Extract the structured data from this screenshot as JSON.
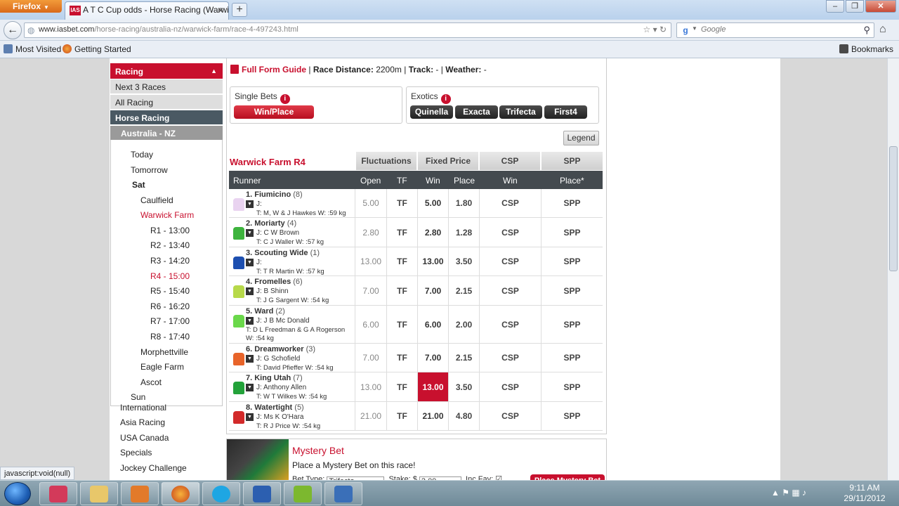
{
  "browser": {
    "menu_button": "Firefox",
    "tab_title": "A T C Cup odds - Horse Racing (Warwic...",
    "url_host": "www.iasbet.com",
    "url_path": "/horse-racing/australia-nz/warwick-farm/race-4-497243.html",
    "search_placeholder": "Google",
    "bookmarks": [
      "Most Visited",
      "Getting Started"
    ],
    "bookmarks_right": "Bookmarks",
    "status": "javascript:void(null)"
  },
  "sidebar": {
    "header": "Racing",
    "items": [
      "Next 3 Races",
      "All Racing"
    ],
    "active": "Horse Racing",
    "region": "Australia - NZ",
    "tree": {
      "today": "Today",
      "tomorrow": "Tomorrow",
      "sat": "Sat",
      "caulfield": "Caulfield",
      "warwick": "Warwick Farm",
      "races": [
        "R1 - 13:00",
        "R2 - 13:40",
        "R3 - 14:20",
        "R4 - 15:00",
        "R5 - 15:40",
        "R6 - 16:20",
        "R7 - 17:00",
        "R8 - 17:40"
      ],
      "morphettville": "Morphettville",
      "eagle_farm": "Eagle Farm",
      "ascot": "Ascot",
      "sun": "Sun"
    },
    "extra": [
      "International",
      "Asia Racing",
      "USA Canada",
      "Specials",
      "Jockey Challenge"
    ]
  },
  "race_info": {
    "form_guide": "Full Form Guide",
    "separator": "|",
    "distance_label": "Race Distance:",
    "distance": "2200m",
    "track_label": "Track:",
    "track": "-",
    "weather_label": "Weather:",
    "weather": "-"
  },
  "bets": {
    "single_title": "Single Bets",
    "single_button": "Win/Place",
    "exotics_title": "Exotics",
    "exotics": [
      "Quinella",
      "Exacta",
      "Trifecta",
      "First4"
    ],
    "legend": "Legend"
  },
  "table": {
    "race_title": "Warwick Farm R4",
    "groups": [
      "Fluctuations",
      "Fixed Price",
      "CSP",
      "SPP"
    ],
    "headers": [
      "Runner",
      "Open",
      "TF",
      "Win",
      "Place",
      "Win",
      "Place*"
    ],
    "runners": [
      {
        "name": "1. Fiumicino",
        "barrier": "(8)",
        "jockey": "J:",
        "trainer": "T: M, W & J Hawkes W: :59 kg",
        "open": "5.00",
        "tf": "TF",
        "win": "5.00",
        "place": "1.80",
        "csp": "CSP",
        "spp": "SPP",
        "silk": "#e9d3f0"
      },
      {
        "name": "2. Moriarty",
        "barrier": "(4)",
        "jockey": "J: C W Brown",
        "trainer": "T: C J Waller W: :57 kg",
        "open": "2.80",
        "tf": "TF",
        "win": "2.80",
        "place": "1.28",
        "csp": "CSP",
        "spp": "SPP",
        "silk": "#3db33d"
      },
      {
        "name": "3. Scouting Wide",
        "barrier": "(1)",
        "jockey": "J:",
        "trainer": "T: T R Martin W: :57 kg",
        "open": "13.00",
        "tf": "TF",
        "win": "13.00",
        "place": "3.50",
        "csp": "CSP",
        "spp": "SPP",
        "silk": "#1d4fb0"
      },
      {
        "name": "4. Fromelles",
        "barrier": "(6)",
        "jockey": "J: B Shinn",
        "trainer": "T: J G Sargent W: :54 kg",
        "open": "7.00",
        "tf": "TF",
        "win": "7.00",
        "place": "2.15",
        "csp": "CSP",
        "spp": "SPP",
        "silk": "#b7d94a"
      },
      {
        "name": "5. Ward",
        "barrier": "(2)",
        "jockey": "J: J B Mc Donald",
        "trainer": "T: D L Freedman & G A Rogerson W: :54 kg",
        "open": "6.00",
        "tf": "TF",
        "win": "6.00",
        "place": "2.00",
        "csp": "CSP",
        "spp": "SPP",
        "silk": "#6ad84a"
      },
      {
        "name": "6. Dreamworker",
        "barrier": "(3)",
        "jockey": "J: G Schofield",
        "trainer": "T: David Pfieffer W: :54 kg",
        "open": "7.00",
        "tf": "TF",
        "win": "7.00",
        "place": "2.15",
        "csp": "CSP",
        "spp": "SPP",
        "silk": "#e8642a"
      },
      {
        "name": "7. King Utah",
        "barrier": "(7)",
        "jockey": "J: Anthony Allen",
        "trainer": "T: W T Wilkes W: :54 kg",
        "open": "13.00",
        "tf": "TF",
        "win": "13.00",
        "place": "3.50",
        "csp": "CSP",
        "spp": "SPP",
        "silk": "#23a23a"
      },
      {
        "name": "8. Watertight",
        "barrier": "(5)",
        "jockey": "J: Ms K O'Hara",
        "trainer": "T: R J Price W: :54 kg",
        "open": "21.00",
        "tf": "TF",
        "win": "21.00",
        "place": "4.80",
        "csp": "CSP",
        "spp": "SPP",
        "silk": "#d22a2a"
      }
    ]
  },
  "mystery": {
    "title": "Mystery Bet",
    "subtitle": "Place a Mystery Bet on this race!",
    "bet_type_label": "Bet Type:",
    "bet_type": "Trifecta",
    "stake_label": "Stake: $",
    "stake": "3.00",
    "inc_fav_label": "Inc Fav:",
    "button": "Place Mystery Bet"
  },
  "taskbar": {
    "time": "9:11 AM",
    "date": "29/11/2012"
  },
  "colors": {
    "brand_red": "#c8102e",
    "table_header": "#444a4f"
  }
}
